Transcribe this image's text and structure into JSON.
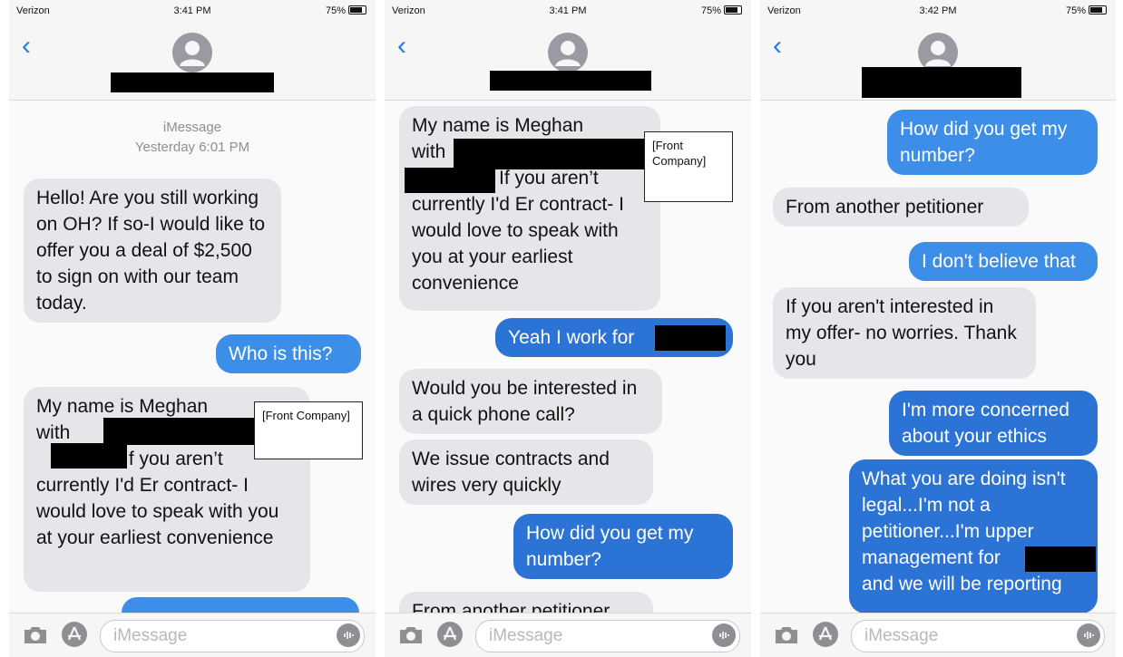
{
  "status": [
    {
      "carrier": "Verizon",
      "time": "3:41 PM",
      "battery": "75%"
    },
    {
      "carrier": "Verizon",
      "time": "3:41 PM",
      "battery": "75%"
    },
    {
      "carrier": "Verizon",
      "time": "3:42 PM",
      "battery": "75%"
    }
  ],
  "input_placeholder": "iMessage",
  "icons": [
    "back-chevron-icon",
    "contact-avatar-icon",
    "camera-icon",
    "app-store-icon",
    "microphone-icon"
  ],
  "colors": {
    "incoming": "#e6e6ea",
    "outgoing": "#3c8ee8",
    "outgoing_dark": "#2c73d6",
    "redaction": "#000000"
  },
  "screen1": {
    "thread_label": "iMessage",
    "thread_time": "Yesterday 6:01 PM",
    "messages": [
      {
        "dir": "in",
        "text": "Hello! Are you still working on OH? If so-I would like to offer you a deal of $2,500 to sign on with our team today."
      },
      {
        "dir": "out",
        "text": "Who is this?"
      },
      {
        "dir": "in",
        "l1": "My name is Meghan",
        "l2": "with",
        "l3": "If you aren’t",
        "rest": "currently I'd Er contract- I would love to speak with  you at your earliest convenience"
      }
    ],
    "annotation": "[Front Company]"
  },
  "screen2": {
    "messages": [
      {
        "dir": "in",
        "l1": "My name is Meghan",
        "l2": "with",
        "l3": "If you aren’t",
        "rest": "currently I'd Er contract- I would love to speak with  you at your earliest convenience"
      },
      {
        "dir": "out",
        "text": "Yeah I work for"
      },
      {
        "dir": "in",
        "text": "Would you be interested in a quick phone call?"
      },
      {
        "dir": "in",
        "text": "We issue contracts and wires very quickly"
      },
      {
        "dir": "out",
        "text": "How did you get my number?"
      },
      {
        "dir": "in",
        "text": "From another petitioner"
      }
    ],
    "annotation": "[Front Company]"
  },
  "screen3": {
    "messages": [
      {
        "dir": "out",
        "text": "How did you get my number?"
      },
      {
        "dir": "in",
        "text": "From another petitioner"
      },
      {
        "dir": "out",
        "text": "I don't believe that"
      },
      {
        "dir": "in",
        "text": "If you aren't interested in my offer- no worries. Thank you"
      },
      {
        "dir": "out",
        "text": "I'm more concerned about your ethics"
      },
      {
        "dir": "out",
        "l1": "What you are doing isn't legal...I'm not a petitioner...I'm upper management for",
        "l2": "and we will be reporting"
      }
    ]
  }
}
